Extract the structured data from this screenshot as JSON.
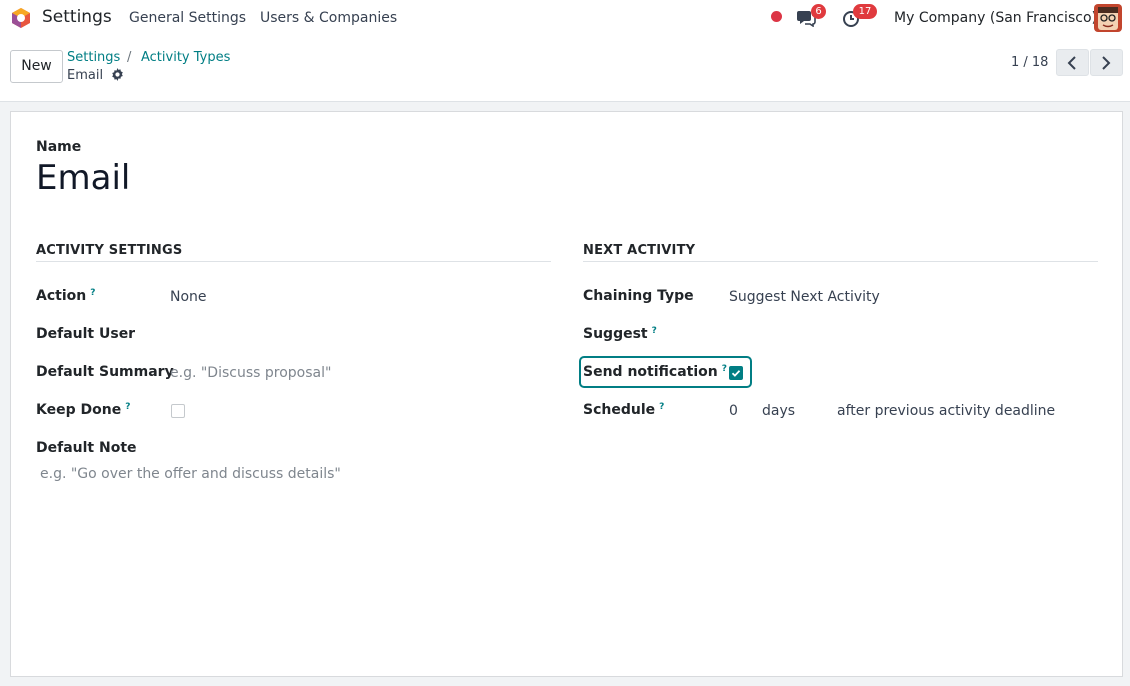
{
  "navbar": {
    "app_name": "Settings",
    "menu": [
      "General Settings",
      "Users & Companies"
    ],
    "messages_count": "6",
    "activities_count": "17",
    "company": "My Company (San Francisco)"
  },
  "control_panel": {
    "new_label": "New",
    "breadcrumb": [
      "Settings",
      "Activity Types"
    ],
    "breadcrumb_sep": "/",
    "current": "Email",
    "pager": "1 / 18"
  },
  "form": {
    "name_label": "Name",
    "name_value": "Email",
    "activity_settings": {
      "title": "ACTIVITY SETTINGS",
      "action_label": "Action",
      "action_value": "None",
      "default_user_label": "Default User",
      "default_summary_label": "Default Summary",
      "default_summary_placeholder": "e.g. \"Discuss proposal\"",
      "keep_done_label": "Keep Done",
      "keep_done_checked": false,
      "default_note_label": "Default Note",
      "default_note_placeholder": "e.g. \"Go over the offer and discuss details\""
    },
    "next_activity": {
      "title": "NEXT ACTIVITY",
      "chaining_type_label": "Chaining Type",
      "chaining_type_value": "Suggest Next Activity",
      "suggest_label": "Suggest",
      "send_notification_label": "Send notification",
      "send_notification_checked": true,
      "schedule_label": "Schedule",
      "schedule_value": "0",
      "schedule_unit": "days",
      "schedule_relative": "after previous activity deadline"
    },
    "help_marker": "?"
  },
  "colors": {
    "accent": "#017e84",
    "badge": "#e03a3e",
    "status_dot": "#dc3545"
  }
}
